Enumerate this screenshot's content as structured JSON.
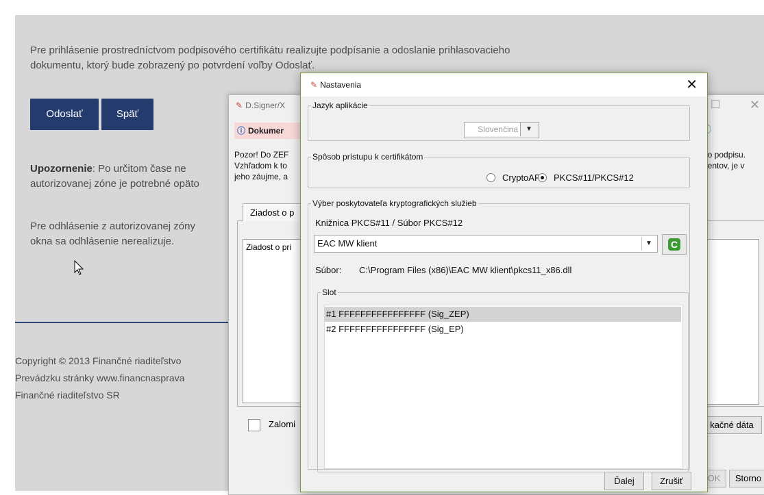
{
  "web": {
    "intro_line1": "Pre prihlásenie prostredníctvom podpisového certifikátu realizujte podpísanie a odoslanie prihlasovacieho",
    "intro_line2": "dokumentu, ktorý bude zobrazený po potvrdení voľby Odoslať.",
    "send_button": "Odoslať",
    "back_button": "Späť",
    "warning_bold": "Upozornenie",
    "warning_rest": ": Po určitom čase ne",
    "warning_line2": "autorizovanej zóne je potrebné opäto",
    "logout_line1": "Pre odhlásenie z autorizovanej zóny",
    "logout_line2": "okna sa odhlásenie nerealizuje.",
    "footer_line1": "Copyright © 2013 Finančné riaditeľstvo",
    "footer_line2": "Prevádzku stránky www.financnasprava",
    "footer_line3": "Finančné riaditeľstvo SR",
    "brand_color": "#243b6e"
  },
  "dsigner": {
    "title": "D.Signer/X",
    "banner": "Dokumer",
    "warn_l1": "Pozor! Do ZEF",
    "warn_l2": "Vzhľadom k to",
    "warn_l3": "jeho záujme, a",
    "warn_r1": "ho podpisu.",
    "warn_r2": "nentov, je v",
    "tab_label": "Ziadost o p",
    "textarea_text": "Ziadost o pri",
    "wrap_checkbox": "Zalomi",
    "certdata_button": "kačné dáta",
    "ok_button": "OK",
    "cancel_button": "Storno"
  },
  "dialog": {
    "title": "Nastavenia",
    "language_group": "Jazyk aplikácie",
    "language_value": "Slovenčina",
    "access_group": "Spôsob prístupu k certifikátom",
    "radio_cryptoapi": "CryptoAPI",
    "radio_pkcs": "PKCS#11/PKCS#12",
    "selected_access": "PKCS#11/PKCS#12",
    "provider_group": "Výber poskytovateľa kryptografických služieb",
    "library_label": "Knižnica PKCS#11 / Súbor PKCS#12",
    "library_value": "EAC MW klient",
    "file_label": "Súbor:",
    "file_path": "C:\\Program Files (x86)\\EAC MW klient\\pkcs11_x86.dll",
    "slot_group": "Slot",
    "slots": [
      "#1 FFFFFFFFFFFFFFFF (Sig_ZEP)",
      "#2 FFFFFFFFFFFFFFFF (Sig_EP)"
    ],
    "next_button": "Ďalej",
    "cancel_button": "Zrušiť"
  }
}
